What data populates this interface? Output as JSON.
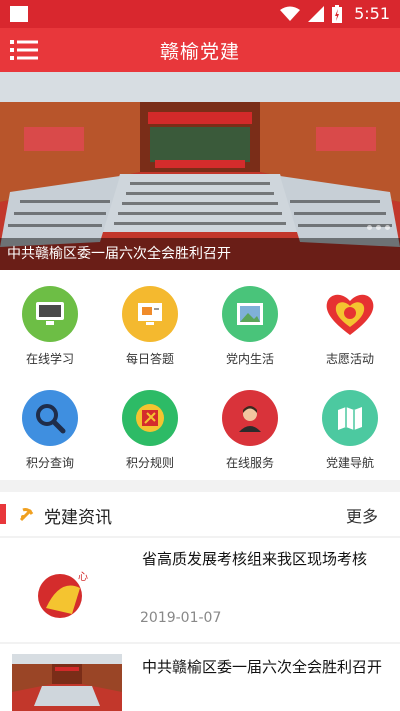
{
  "status": {
    "time": "5:51"
  },
  "appbar": {
    "title": "赣榆党建"
  },
  "banner": {
    "caption": "中共赣榆区委一届六次全会胜利召开"
  },
  "grid": [
    {
      "label": "在线学习",
      "color": "#6dbe45",
      "icon": "computer-icon"
    },
    {
      "label": "每日答题",
      "color": "#f4b92f",
      "icon": "quiz-icon"
    },
    {
      "label": "党内生活",
      "color": "#49c47a",
      "icon": "picture-icon"
    },
    {
      "label": "志愿活动",
      "color": "#ffffff",
      "icon": "heart-emblem-icon"
    },
    {
      "label": "积分查询",
      "color": "#3f8fe0",
      "icon": "search-icon"
    },
    {
      "label": "积分规则",
      "color": "#2dbb66",
      "icon": "party-emblem-icon"
    },
    {
      "label": "在线服务",
      "color": "#d9333a",
      "icon": "agent-icon"
    },
    {
      "label": "党建导航",
      "color": "#4cc9a0",
      "icon": "map-icon"
    }
  ],
  "news": {
    "title": "党建资讯",
    "more": "更多",
    "items": [
      {
        "headline": "省高质发展考核组来我区现场考核",
        "date": "2019-01-07"
      },
      {
        "headline": "中共赣榆区委一届六次全会胜利召开"
      }
    ]
  }
}
